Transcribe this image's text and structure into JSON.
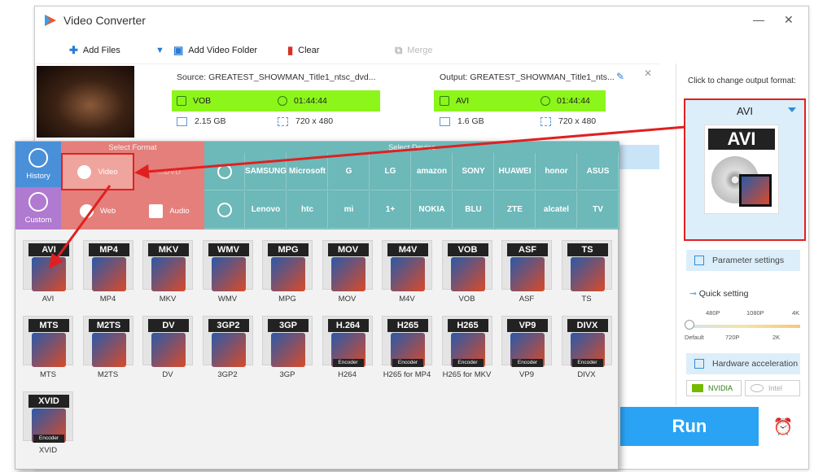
{
  "window": {
    "title": "Video Converter"
  },
  "toolbar": {
    "add_files": "Add Files",
    "add_folder": "Add Video Folder",
    "clear": "Clear",
    "merge": "Merge"
  },
  "file": {
    "source": "Source: GREATEST_SHOWMAN_Title1_ntsc_dvd...",
    "output": "Output: GREATEST_SHOWMAN_Title1_nts...",
    "src_format": "VOB",
    "src_duration": "01:44:44",
    "out_format": "AVI",
    "out_duration": "01:44:44",
    "src_size": "2.15 GB",
    "src_res": "720 x 480",
    "out_size": "1.6 GB",
    "out_res": "720 x 480"
  },
  "right": {
    "click_to_change": "Click to change output format:",
    "format": "AVI",
    "format_icon": "AVI",
    "param": "Parameter settings",
    "quick": "Quick setting",
    "ticks_top": [
      "480P",
      "1080P",
      "4K"
    ],
    "ticks_bottom": [
      "Default",
      "720P",
      "2K"
    ],
    "hw": "Hardware acceleration",
    "nvidia": "NVIDIA",
    "intel": "Intel",
    "run": "Run"
  },
  "popup": {
    "select_format": "Select Format",
    "select_device": "Select Device",
    "history": "History",
    "custom": "Custom",
    "cats": {
      "video": "Video",
      "dvd": "...DVD",
      "web": "Web",
      "audio": "Audio"
    },
    "brands_row1": [
      "",
      "SAMSUNG",
      "Microsoft",
      "G",
      "LG",
      "amazon",
      "SONY",
      "HUAWEI",
      "honor",
      "ASUS"
    ],
    "brands_row2": [
      "",
      "Lenovo",
      "htc",
      "mi",
      "1+",
      "NOKIA",
      "BLU",
      "ZTE",
      "alcatel",
      "TV"
    ],
    "formats": [
      {
        "icon": "AVI",
        "name": "AVI"
      },
      {
        "icon": "MP4",
        "name": "MP4"
      },
      {
        "icon": "MKV",
        "name": "MKV"
      },
      {
        "icon": "WMV",
        "name": "WMV"
      },
      {
        "icon": "MPG",
        "name": "MPG"
      },
      {
        "icon": "MOV",
        "name": "MOV"
      },
      {
        "icon": "M4V",
        "name": "M4V"
      },
      {
        "icon": "VOB",
        "name": "VOB"
      },
      {
        "icon": "ASF",
        "name": "ASF"
      },
      {
        "icon": "TS",
        "name": "TS"
      },
      {
        "icon": "MTS",
        "name": "MTS"
      },
      {
        "icon": "M2TS",
        "name": "M2TS"
      },
      {
        "icon": "DV",
        "name": "DV"
      },
      {
        "icon": "3GP2",
        "name": "3GP2"
      },
      {
        "icon": "3GP",
        "name": "3GP"
      },
      {
        "icon": "H.264",
        "name": "H264",
        "enc": "Encoder"
      },
      {
        "icon": "H265",
        "name": "H265 for MP4",
        "enc": "Encoder"
      },
      {
        "icon": "H265",
        "name": "H265 for MKV",
        "enc": "Encoder"
      },
      {
        "icon": "VP9",
        "name": "VP9",
        "enc": "Encoder"
      },
      {
        "icon": "DIVX",
        "name": "DIVX",
        "enc": "Encoder"
      },
      {
        "icon": "XVID",
        "name": "XVID",
        "enc": "Encoder"
      }
    ]
  },
  "colors": {
    "accent": "#2aa3f5",
    "green": "#8cf51a",
    "highlight": "#e02020"
  }
}
